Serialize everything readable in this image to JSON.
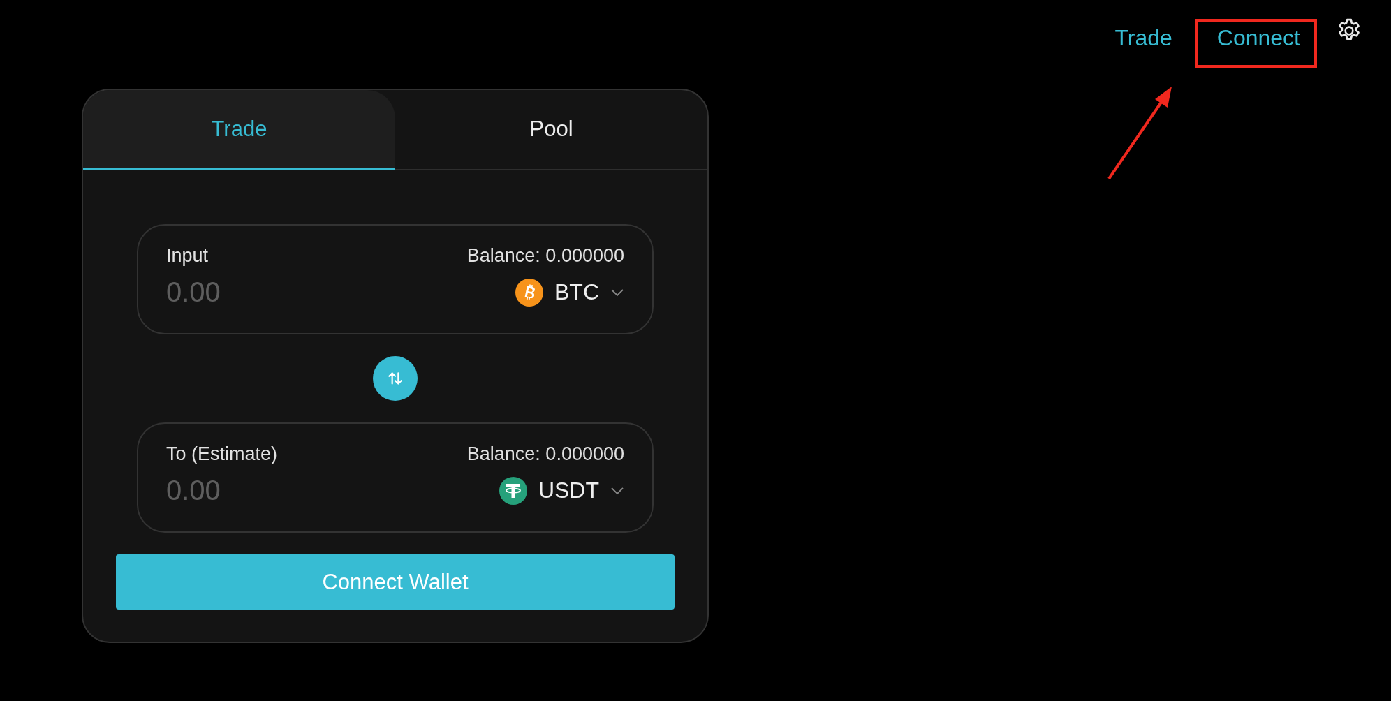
{
  "nav": {
    "links": [
      {
        "label": "Trade"
      },
      {
        "label": "Connect",
        "highlighted": true
      }
    ]
  },
  "tabs": [
    {
      "label": "Trade",
      "selected": true
    },
    {
      "label": "Pool",
      "selected": false
    }
  ],
  "fields": [
    {
      "label": "Input",
      "balance": "Balance: 0.000000",
      "placeholder": "0.00",
      "token": "BTC",
      "kind": "btc"
    },
    {
      "label": "To (Estimate)",
      "balance": "Balance: 0.000000",
      "placeholder": "0.00",
      "token": "USDT",
      "kind": "usdt"
    }
  ],
  "action_button": "Connect Wallet"
}
